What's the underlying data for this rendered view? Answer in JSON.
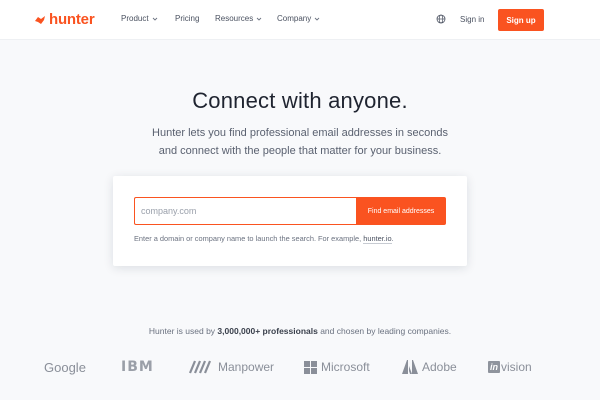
{
  "brand": {
    "name": "hunter",
    "color": "#fa5320",
    "icon": "hunter-logo-icon"
  },
  "nav": {
    "items": [
      {
        "label": "Product",
        "has_dropdown": true
      },
      {
        "label": "Pricing",
        "has_dropdown": false
      },
      {
        "label": "Resources",
        "has_dropdown": true
      },
      {
        "label": "Company",
        "has_dropdown": true
      }
    ],
    "language_icon": "globe-icon",
    "signin_label": "Sign in",
    "signup_label": "Sign up"
  },
  "hero": {
    "headline": "Connect with anyone.",
    "sub_line1": "Hunter lets you find professional email addresses in seconds",
    "sub_line2": "and connect with the people that matter for your business."
  },
  "search": {
    "placeholder": "company.com",
    "value": "",
    "button_label": "Find email addresses",
    "hint_prefix": "Enter a domain or company name to launch the search. For example, ",
    "hint_example": "hunter.io",
    "hint_suffix": "."
  },
  "trust": {
    "prefix": "Hunter is used by ",
    "highlight": "3,000,000+ professionals",
    "suffix": " and chosen by leading companies."
  },
  "logos": [
    {
      "name": "Google"
    },
    {
      "name": "IBM"
    },
    {
      "name": "Manpower"
    },
    {
      "name": "Microsoft"
    },
    {
      "name": "Adobe"
    },
    {
      "name_mark": "in",
      "name": "vision"
    }
  ],
  "colors": {
    "accent": "#fa5320",
    "background": "#f8f9fb",
    "text": "#1f2430",
    "muted": "#6b7280"
  }
}
